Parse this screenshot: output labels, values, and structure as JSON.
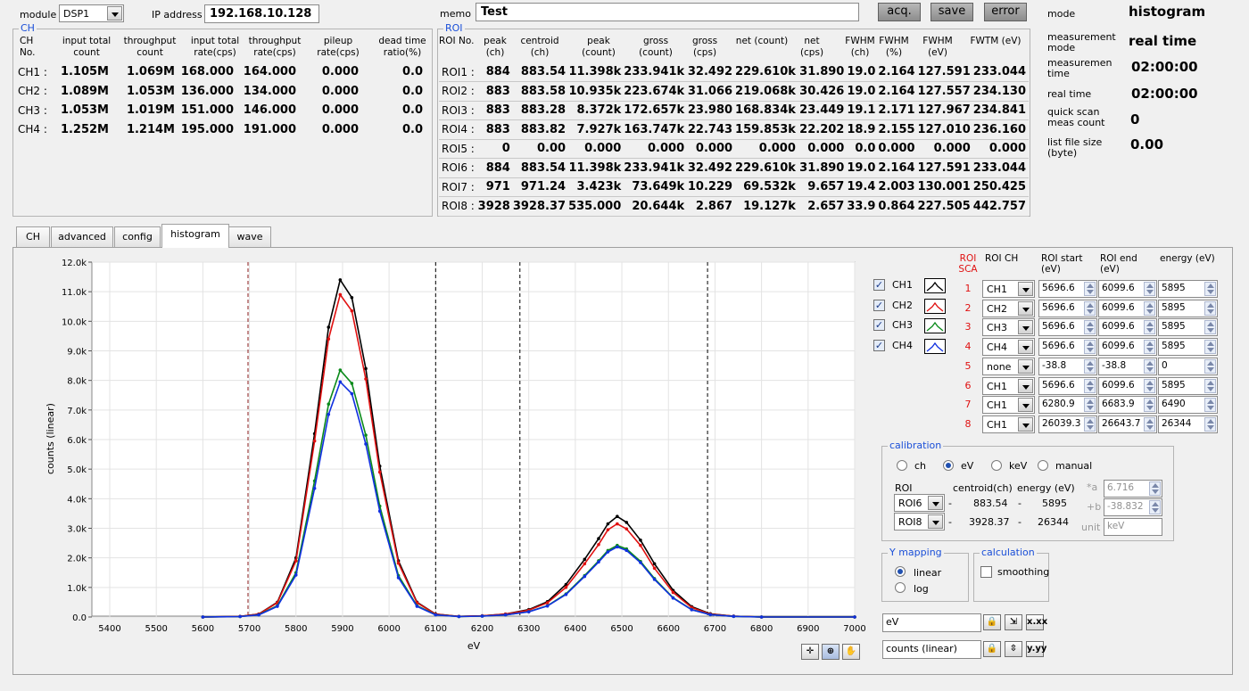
{
  "header": {
    "module_label": "module",
    "module_value": "DSP1",
    "ip_label": "IP address",
    "ip_value": "192.168.10.128",
    "memo_label": "memo",
    "memo_value": "Test",
    "acq_label": "acq.",
    "save_label": "save",
    "error_label": "error"
  },
  "status": {
    "mode_label": "mode",
    "mode_value": "histogram",
    "meas_mode_label": "measurement mode",
    "meas_mode_value": "real time",
    "meas_time_label": "measuremen time",
    "meas_time_value": "02:00:00",
    "real_time_label": "real time",
    "real_time_value": "02:00:00",
    "quick_scan_label": "quick scan meas count",
    "quick_scan_value": "0",
    "list_size_label": "list file size (byte)",
    "list_size_value": "0.00"
  },
  "ch_group": {
    "title": "CH",
    "headers": [
      "CH No.",
      "input total count",
      "throughput count",
      "input total rate(cps)",
      "throughput rate(cps)",
      "pileup rate(cps)",
      "dead time ratio(%)"
    ],
    "rows": [
      [
        "CH1 :",
        "1.105M",
        "1.069M",
        "168.000",
        "164.000",
        "0.000",
        "0.0"
      ],
      [
        "CH2 :",
        "1.089M",
        "1.053M",
        "136.000",
        "134.000",
        "0.000",
        "0.0"
      ],
      [
        "CH3 :",
        "1.053M",
        "1.019M",
        "151.000",
        "146.000",
        "0.000",
        "0.0"
      ],
      [
        "CH4 :",
        "1.252M",
        "1.214M",
        "195.000",
        "191.000",
        "0.000",
        "0.0"
      ]
    ]
  },
  "roi_group": {
    "title": "ROI",
    "headers": [
      "ROI No.",
      "peak (ch)",
      "centroid (ch)",
      "peak (count)",
      "gross (count)",
      "gross (cps)",
      "net (count)",
      "net (cps)",
      "FWHM (ch)",
      "FWHM (%)",
      "FWHM (eV)",
      "FWTM (eV)"
    ],
    "rows": [
      [
        "ROI1 :",
        "884",
        "883.54",
        "11.398k",
        "233.941k",
        "32.492",
        "229.610k",
        "31.890",
        "19.0",
        "2.164",
        "127.591",
        "233.044"
      ],
      [
        "ROI2 :",
        "883",
        "883.58",
        "10.935k",
        "223.674k",
        "31.066",
        "219.068k",
        "30.426",
        "19.0",
        "2.164",
        "127.557",
        "234.130"
      ],
      [
        "ROI3 :",
        "883",
        "883.28",
        "8.372k",
        "172.657k",
        "23.980",
        "168.834k",
        "23.449",
        "19.1",
        "2.171",
        "127.967",
        "234.841"
      ],
      [
        "ROI4 :",
        "883",
        "883.82",
        "7.927k",
        "163.747k",
        "22.743",
        "159.853k",
        "22.202",
        "18.9",
        "2.155",
        "127.010",
        "236.160"
      ],
      [
        "ROI5 :",
        "0",
        "0.00",
        "0.000",
        "0.000",
        "0.000",
        "0.000",
        "0.000",
        "0.0",
        "0.000",
        "0.000",
        "0.000"
      ],
      [
        "ROI6 :",
        "884",
        "883.54",
        "11.398k",
        "233.941k",
        "32.492",
        "229.610k",
        "31.890",
        "19.0",
        "2.164",
        "127.591",
        "233.044"
      ],
      [
        "ROI7 :",
        "971",
        "971.24",
        "3.423k",
        "73.649k",
        "10.229",
        "69.532k",
        "9.657",
        "19.4",
        "2.003",
        "130.001",
        "250.425"
      ],
      [
        "ROI8 :",
        "3928",
        "3928.37",
        "535.000",
        "20.644k",
        "2.867",
        "19.127k",
        "2.657",
        "33.9",
        "0.864",
        "227.505",
        "442.757"
      ]
    ]
  },
  "tabs": [
    "CH",
    "advanced",
    "config",
    "histogram",
    "wave"
  ],
  "legend": [
    {
      "label": "CH1",
      "color": "#000000"
    },
    {
      "label": "CH2",
      "color": "#e01010"
    },
    {
      "label": "CH3",
      "color": "#0a8a1a"
    },
    {
      "label": "CH4",
      "color": "#1030e0"
    }
  ],
  "sca": {
    "headers": [
      "ROI SCA",
      "ROI CH",
      "ROI start (eV)",
      "ROI end (eV)",
      "energy (eV)"
    ],
    "rows": [
      [
        "1",
        "CH1",
        "5696.6",
        "6099.6",
        "5895"
      ],
      [
        "2",
        "CH2",
        "5696.6",
        "6099.6",
        "5895"
      ],
      [
        "3",
        "CH3",
        "5696.6",
        "6099.6",
        "5895"
      ],
      [
        "4",
        "CH4",
        "5696.6",
        "6099.6",
        "5895"
      ],
      [
        "5",
        "none",
        "-38.8",
        "-38.8",
        "0"
      ],
      [
        "6",
        "CH1",
        "5696.6",
        "6099.6",
        "5895"
      ],
      [
        "7",
        "CH1",
        "6280.9",
        "6683.9",
        "6490"
      ],
      [
        "8",
        "CH1",
        "26039.3",
        "26643.7",
        "26344"
      ]
    ]
  },
  "calibration": {
    "title": "calibration",
    "options": [
      "ch",
      "eV",
      "keV",
      "manual"
    ],
    "roi_label": "ROI",
    "centroid_label": "centroid(ch)",
    "energy_label": "energy (eV)",
    "row1": {
      "roi": "ROI6",
      "centroid": "883.54",
      "energy": "5895"
    },
    "row2": {
      "roi": "ROI8",
      "centroid": "3928.37",
      "energy": "26344"
    },
    "a_label": "*a",
    "a_value": "6.716",
    "b_label": "+b",
    "b_value": "-38.832",
    "unit_label": "unit",
    "unit_value": "keV",
    "dash": "-"
  },
  "ymapping": {
    "title": "Y mapping",
    "options": [
      "linear",
      "log"
    ]
  },
  "calculation": {
    "title": "calculation",
    "smoothing": "smoothing"
  },
  "axis_fields": {
    "x": "eV",
    "y": "counts (linear)"
  },
  "chart_data": {
    "type": "line",
    "xlabel": "eV",
    "ylabel": "counts (linear)",
    "xlim": [
      5400,
      7000
    ],
    "ylim": [
      0,
      12000
    ],
    "x_ticks": [
      5400,
      5500,
      5600,
      5700,
      5800,
      5900,
      6000,
      6100,
      6200,
      6300,
      6400,
      6500,
      6600,
      6700,
      6800,
      6900,
      7000
    ],
    "y_ticks": [
      "0.0",
      "1.0k",
      "2.0k",
      "3.0k",
      "4.0k",
      "5.0k",
      "6.0k",
      "7.0k",
      "8.0k",
      "9.0k",
      "10.0k",
      "11.0k",
      "12.0k"
    ],
    "grid": true,
    "roi_markers": [
      {
        "x": 5697,
        "color": "#8b1a1a"
      },
      {
        "x": 6100,
        "color": "#000000"
      },
      {
        "x": 6281,
        "color": "#000000"
      },
      {
        "x": 6684,
        "color": "#000000"
      }
    ],
    "series": [
      {
        "name": "CH1",
        "color": "#000000",
        "x": [
          5600,
          5680,
          5720,
          5760,
          5800,
          5840,
          5870,
          5895,
          5920,
          5950,
          5980,
          6020,
          6060,
          6100,
          6150,
          6200,
          6250,
          6300,
          6340,
          6380,
          6420,
          6450,
          6470,
          6490,
          6510,
          6540,
          6570,
          6610,
          6650,
          6690,
          6740,
          6800,
          7000
        ],
        "y": [
          0,
          20,
          100,
          500,
          2000,
          6200,
          9800,
          11400,
          10800,
          8400,
          5100,
          1900,
          500,
          100,
          20,
          40,
          100,
          250,
          520,
          1100,
          1950,
          2650,
          3150,
          3400,
          3200,
          2600,
          1800,
          900,
          350,
          110,
          30,
          0,
          0
        ]
      },
      {
        "name": "CH2",
        "color": "#e01010",
        "x": [
          5600,
          5680,
          5720,
          5760,
          5800,
          5840,
          5870,
          5895,
          5920,
          5950,
          5980,
          6020,
          6060,
          6100,
          6150,
          6200,
          6250,
          6300,
          6340,
          6380,
          6420,
          6450,
          6470,
          6490,
          6510,
          6540,
          6570,
          6610,
          6650,
          6690,
          6740,
          6800,
          7000
        ],
        "y": [
          0,
          20,
          95,
          480,
          1900,
          5950,
          9400,
          10900,
          10350,
          8050,
          4900,
          1820,
          480,
          95,
          20,
          40,
          95,
          230,
          480,
          1000,
          1800,
          2450,
          2950,
          3150,
          2980,
          2420,
          1650,
          830,
          320,
          100,
          30,
          0,
          0
        ]
      },
      {
        "name": "CH3",
        "color": "#0a8a1a",
        "x": [
          5600,
          5680,
          5720,
          5760,
          5800,
          5840,
          5870,
          5895,
          5920,
          5950,
          5980,
          6020,
          6060,
          6100,
          6150,
          6200,
          6250,
          6300,
          6340,
          6380,
          6420,
          6450,
          6470,
          6490,
          6510,
          6540,
          6570,
          6610,
          6650,
          6690,
          6740,
          6800,
          7000
        ],
        "y": [
          0,
          15,
          75,
          380,
          1500,
          4600,
          7200,
          8350,
          7900,
          6150,
          3750,
          1400,
          380,
          75,
          15,
          30,
          70,
          180,
          380,
          780,
          1400,
          1900,
          2250,
          2420,
          2300,
          1880,
          1300,
          650,
          250,
          80,
          20,
          0,
          0
        ]
      },
      {
        "name": "CH4",
        "color": "#1030e0",
        "x": [
          5600,
          5680,
          5720,
          5760,
          5800,
          5840,
          5870,
          5895,
          5920,
          5950,
          5980,
          6020,
          6060,
          6100,
          6150,
          6200,
          6250,
          6300,
          6340,
          6380,
          6420,
          6450,
          6470,
          6490,
          6510,
          6540,
          6570,
          6610,
          6650,
          6690,
          6740,
          6800,
          7000
        ],
        "y": [
          0,
          15,
          70,
          360,
          1420,
          4350,
          6850,
          7950,
          7550,
          5850,
          3580,
          1330,
          360,
          70,
          15,
          30,
          70,
          175,
          370,
          760,
          1370,
          1860,
          2200,
          2370,
          2250,
          1840,
          1270,
          640,
          245,
          78,
          20,
          0,
          0
        ]
      }
    ]
  }
}
